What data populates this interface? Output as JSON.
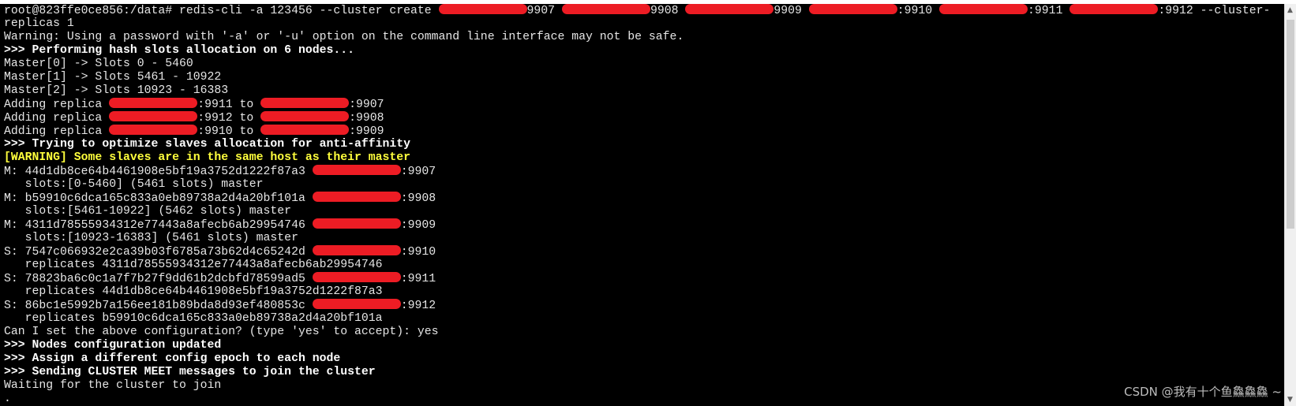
{
  "terminal": {
    "lines": [
      {
        "style": "normal",
        "segments": [
          {
            "t": "root@823ffe0ce856:/data# redis-cli -a 123456 --cluster create "
          },
          {
            "r": true
          },
          {
            "t": "9907 "
          },
          {
            "r": true
          },
          {
            "t": "9908 "
          },
          {
            "r": true
          },
          {
            "t": "9909 "
          },
          {
            "r": true
          },
          {
            "t": ":9910 "
          },
          {
            "r": true
          },
          {
            "t": ":9911 "
          },
          {
            "r": true
          },
          {
            "t": ":9912 --cluster-"
          }
        ]
      },
      {
        "style": "normal",
        "segments": [
          {
            "t": "replicas 1"
          }
        ]
      },
      {
        "style": "normal",
        "segments": [
          {
            "t": "Warning: Using a password with '-a' or '-u' option on the command line interface may not be safe."
          }
        ]
      },
      {
        "style": "bold",
        "segments": [
          {
            "t": ">>> Performing hash slots allocation on 6 nodes..."
          }
        ]
      },
      {
        "style": "normal",
        "segments": [
          {
            "t": "Master[0] -> Slots 0 - 5460"
          }
        ]
      },
      {
        "style": "normal",
        "segments": [
          {
            "t": "Master[1] -> Slots 5461 - 10922"
          }
        ]
      },
      {
        "style": "normal",
        "segments": [
          {
            "t": "Master[2] -> Slots 10923 - 16383"
          }
        ]
      },
      {
        "style": "normal",
        "segments": [
          {
            "t": "Adding replica "
          },
          {
            "r": true
          },
          {
            "t": ":9911 to "
          },
          {
            "r": true
          },
          {
            "t": ":9907"
          }
        ]
      },
      {
        "style": "normal",
        "segments": [
          {
            "t": "Adding replica "
          },
          {
            "r": true
          },
          {
            "t": ":9912 to "
          },
          {
            "r": true
          },
          {
            "t": ":9908"
          }
        ]
      },
      {
        "style": "normal",
        "segments": [
          {
            "t": "Adding replica "
          },
          {
            "r": true
          },
          {
            "t": ":9910 to "
          },
          {
            "r": true
          },
          {
            "t": ":9909"
          }
        ]
      },
      {
        "style": "bold",
        "segments": [
          {
            "t": ">>> Trying to optimize slaves allocation for anti-affinity"
          }
        ]
      },
      {
        "style": "warn",
        "segments": [
          {
            "t": "[WARNING] Some slaves are in the same host as their master"
          }
        ]
      },
      {
        "style": "normal",
        "segments": [
          {
            "t": "M: 44d1db8ce64b4461908e5bf19a3752d1222f87a3 "
          },
          {
            "r": true
          },
          {
            "t": ":9907"
          }
        ]
      },
      {
        "style": "normal",
        "segments": [
          {
            "t": "   slots:[0-5460] (5461 slots) master"
          }
        ]
      },
      {
        "style": "normal",
        "segments": [
          {
            "t": "M: b59910c6dca165c833a0eb89738a2d4a20bf101a "
          },
          {
            "r": true
          },
          {
            "t": ":9908"
          }
        ]
      },
      {
        "style": "normal",
        "segments": [
          {
            "t": "   slots:[5461-10922] (5462 slots) master"
          }
        ]
      },
      {
        "style": "normal",
        "segments": [
          {
            "t": "M: 4311d78555934312e77443a8afecb6ab29954746 "
          },
          {
            "r": true
          },
          {
            "t": ":9909"
          }
        ]
      },
      {
        "style": "normal",
        "segments": [
          {
            "t": "   slots:[10923-16383] (5461 slots) master"
          }
        ]
      },
      {
        "style": "normal",
        "segments": [
          {
            "t": "S: 7547c066932e2ca39b03f6785a73b62d4c65242d "
          },
          {
            "r": true
          },
          {
            "t": ":9910"
          }
        ]
      },
      {
        "style": "normal",
        "segments": [
          {
            "t": "   replicates 4311d78555934312e77443a8afecb6ab29954746"
          }
        ]
      },
      {
        "style": "normal",
        "segments": [
          {
            "t": "S: 78823ba6c0c1a7f7b27f9dd61b2dcbfd78599ad5 "
          },
          {
            "r": true
          },
          {
            "t": ":9911"
          }
        ]
      },
      {
        "style": "normal",
        "segments": [
          {
            "t": "   replicates 44d1db8ce64b4461908e5bf19a3752d1222f87a3"
          }
        ]
      },
      {
        "style": "normal",
        "segments": [
          {
            "t": "S: 86bc1e5992b7a156ee181b89bda8d93ef480853c "
          },
          {
            "r": true
          },
          {
            "t": ":9912"
          }
        ]
      },
      {
        "style": "normal",
        "segments": [
          {
            "t": "   replicates b59910c6dca165c833a0eb89738a2d4a20bf101a"
          }
        ]
      },
      {
        "style": "normal",
        "segments": [
          {
            "t": "Can I set the above configuration? (type 'yes' to accept): yes"
          }
        ]
      },
      {
        "style": "bold",
        "segments": [
          {
            "t": ">>> Nodes configuration updated"
          }
        ]
      },
      {
        "style": "bold",
        "segments": [
          {
            "t": ">>> Assign a different config epoch to each node"
          }
        ]
      },
      {
        "style": "bold",
        "segments": [
          {
            "t": ">>> Sending CLUSTER MEET messages to join the cluster"
          }
        ]
      },
      {
        "style": "normal",
        "segments": [
          {
            "t": "Waiting for the cluster to join"
          }
        ]
      },
      {
        "style": "normal",
        "segments": [
          {
            "t": "."
          }
        ]
      }
    ]
  },
  "watermark": "CSDN @我有十个鱼鱻鱻鱻 ~",
  "colors": {
    "background": "#000000",
    "text": "#e6e6e6",
    "warning": "#ffff3c",
    "redaction": "#ed1c24"
  },
  "scrollbar": {
    "up_icon": "triangle-up",
    "down_icon": "triangle-down"
  }
}
